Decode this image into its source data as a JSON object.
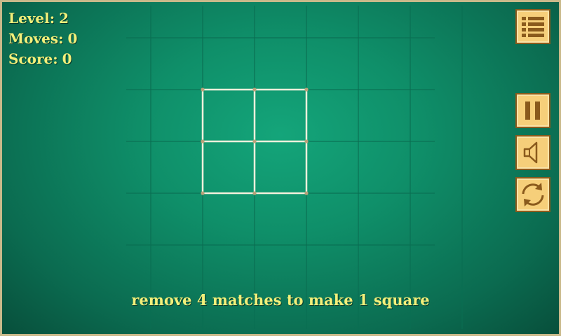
{
  "hud": {
    "level_label": "Level:",
    "level_value": "2",
    "moves_label": "Moves:",
    "moves_value": "0",
    "score_label": "Score:",
    "score_value": "0"
  },
  "hint": "remove 4 matches to make 1 square",
  "buttons": {
    "menu": "menu-list-icon",
    "pause": "pause-icon",
    "sound": "speaker-icon",
    "restart": "restart-icon"
  },
  "puzzle": {
    "grid_rows": 2,
    "grid_cols": 2,
    "matches_total": 12,
    "matches_removed": 0
  },
  "colors": {
    "table": "#0f8f69",
    "text": "#f2f07a",
    "match": "#f4f0dc",
    "button_fill": "#f6cf7a",
    "button_border": "#8a5a1c",
    "frame": "#c9b98a"
  }
}
